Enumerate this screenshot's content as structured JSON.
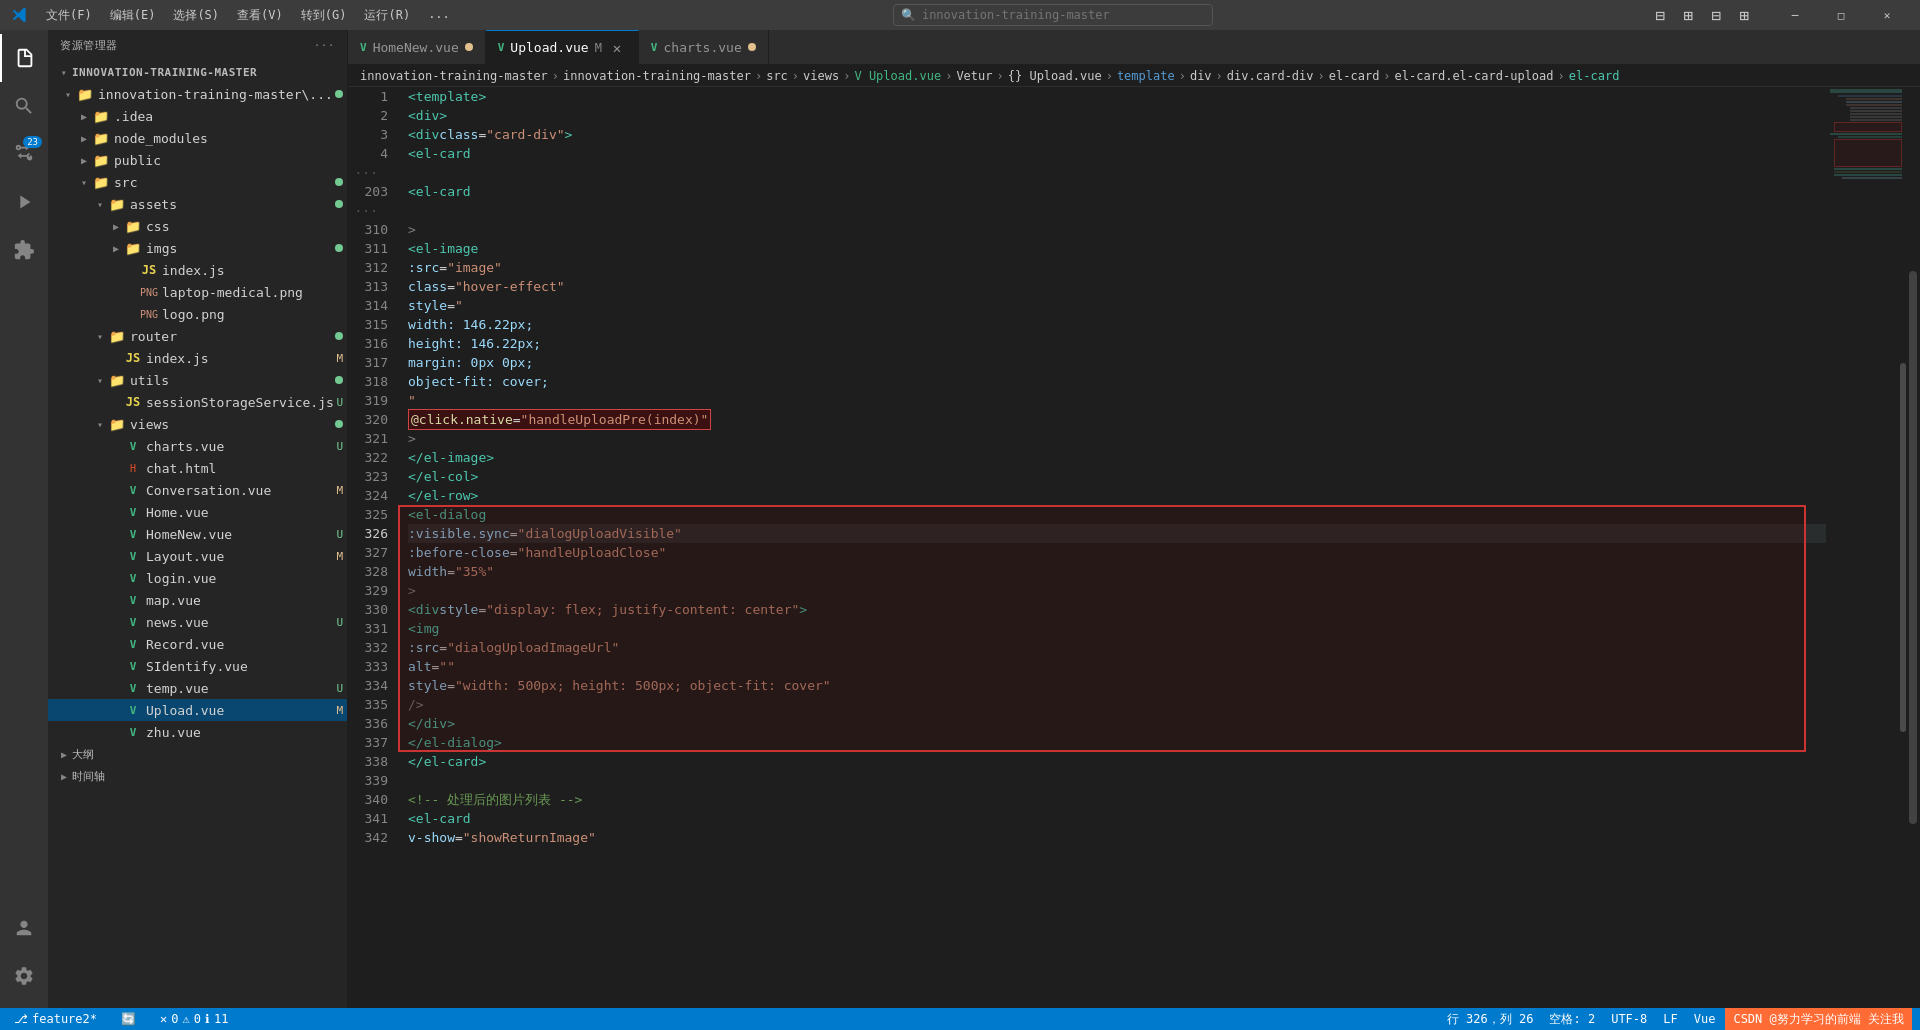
{
  "titlebar": {
    "menu_items": [
      "文件(F)",
      "编辑(E)",
      "选择(S)",
      "查看(V)",
      "转到(G)",
      "运行(R)",
      "..."
    ],
    "search_placeholder": "innovation-training-master",
    "win_min": "─",
    "win_max": "□",
    "win_close": "✕"
  },
  "activity_bar": {
    "icons": [
      {
        "name": "explorer-icon",
        "symbol": "⎘",
        "active": true
      },
      {
        "name": "search-icon",
        "symbol": "🔍",
        "active": false
      },
      {
        "name": "source-control-icon",
        "symbol": "⎇",
        "active": false,
        "badge": "23"
      },
      {
        "name": "run-icon",
        "symbol": "▷",
        "active": false
      },
      {
        "name": "extensions-icon",
        "symbol": "⊞",
        "active": false
      }
    ],
    "bottom_icons": [
      {
        "name": "account-icon",
        "symbol": "👤"
      },
      {
        "name": "settings-icon",
        "symbol": "⚙"
      }
    ]
  },
  "sidebar": {
    "title": "资源管理器",
    "root": "INNOVATION-TRAINING-MASTER",
    "tree": [
      {
        "label": "innovation-training-master\\...",
        "depth": 1,
        "type": "folder",
        "expanded": true,
        "dot": "green"
      },
      {
        "label": ".idea",
        "depth": 2,
        "type": "folder",
        "expanded": false
      },
      {
        "label": "node_modules",
        "depth": 2,
        "type": "folder",
        "expanded": false
      },
      {
        "label": "public",
        "depth": 2,
        "type": "folder",
        "expanded": false
      },
      {
        "label": "src",
        "depth": 2,
        "type": "folder",
        "expanded": true,
        "dot": "green"
      },
      {
        "label": "assets",
        "depth": 3,
        "type": "folder",
        "expanded": true,
        "dot": "green"
      },
      {
        "label": "css",
        "depth": 4,
        "type": "folder",
        "expanded": false
      },
      {
        "label": "imgs",
        "depth": 4,
        "type": "folder",
        "expanded": false,
        "dot": "green"
      },
      {
        "label": "index.js",
        "depth": 4,
        "type": "js"
      },
      {
        "label": "laptop-medical.png",
        "depth": 4,
        "type": "png"
      },
      {
        "label": "logo.png",
        "depth": 4,
        "type": "png"
      },
      {
        "label": "router",
        "depth": 3,
        "type": "folder",
        "expanded": true,
        "dot": "green"
      },
      {
        "label": "index.js",
        "depth": 4,
        "type": "js_m",
        "modified": true
      },
      {
        "label": "utils",
        "depth": 3,
        "type": "folder",
        "expanded": true,
        "dot": "green"
      },
      {
        "label": "sessionStorageService.js",
        "depth": 4,
        "type": "js_u",
        "modified": true
      },
      {
        "label": "views",
        "depth": 3,
        "type": "folder",
        "expanded": true,
        "dot": "green"
      },
      {
        "label": "charts.vue",
        "depth": 4,
        "type": "vue_u",
        "modified": true
      },
      {
        "label": "chat.html",
        "depth": 4,
        "type": "html"
      },
      {
        "label": "Conversation.vue",
        "depth": 4,
        "type": "vue_m",
        "modified": true
      },
      {
        "label": "Home.vue",
        "depth": 4,
        "type": "vue"
      },
      {
        "label": "HomeNew.vue",
        "depth": 4,
        "type": "vue_u",
        "modified": true
      },
      {
        "label": "Layout.vue",
        "depth": 4,
        "type": "vue_m",
        "modified": true
      },
      {
        "label": "login.vue",
        "depth": 4,
        "type": "vue"
      },
      {
        "label": "map.vue",
        "depth": 4,
        "type": "vue"
      },
      {
        "label": "news.vue",
        "depth": 4,
        "type": "vue_u",
        "modified": true
      },
      {
        "label": "Record.vue",
        "depth": 4,
        "type": "vue"
      },
      {
        "label": "SIdentify.vue",
        "depth": 4,
        "type": "vue"
      },
      {
        "label": "temp.vue",
        "depth": 4,
        "type": "vue_u",
        "modified": true
      },
      {
        "label": "Upload.vue",
        "depth": 4,
        "type": "vue_m",
        "active": true,
        "modified": true
      },
      {
        "label": "zhu.vue",
        "depth": 4,
        "type": "vue"
      },
      {
        "label": "大纲",
        "depth": 1,
        "type": "section"
      },
      {
        "label": "时间轴",
        "depth": 1,
        "type": "section"
      }
    ]
  },
  "tabs": [
    {
      "label": "HomeNew.vue",
      "modified": true,
      "active": false,
      "icon": "vue"
    },
    {
      "label": "Upload.vue",
      "modified": true,
      "active": true,
      "icon": "vue",
      "closeable": true
    },
    {
      "label": "charts.vue",
      "modified": false,
      "active": false,
      "icon": "vue"
    }
  ],
  "breadcrumb": {
    "items": [
      "innovation-training-master",
      "innovation-training-master",
      "src",
      "views",
      "Upload.vue",
      "Vetur",
      "{}",
      "Upload.vue",
      "template",
      "div",
      "div.card-div",
      "el-card",
      "el-card.el-card-upload",
      "el-card"
    ]
  },
  "code": {
    "lines": [
      {
        "num": 1,
        "content": "<template>"
      },
      {
        "num": 2,
        "content": "  <div>"
      },
      {
        "num": 3,
        "content": "    <div class=\"card-div\">"
      },
      {
        "num": 4,
        "content": "      <el-card"
      },
      {
        "num": 203,
        "content": "        <el-card"
      },
      {
        "num": 310,
        "content": "          >"
      },
      {
        "num": 311,
        "content": "            <el-image"
      },
      {
        "num": 312,
        "content": "              :src=\"image\""
      },
      {
        "num": 313,
        "content": "              class=\"hover-effect\""
      },
      {
        "num": 314,
        "content": "              style=\""
      },
      {
        "num": 315,
        "content": "                width: 146.22px;"
      },
      {
        "num": 316,
        "content": "                height: 146.22px;"
      },
      {
        "num": 317,
        "content": "                margin: 0px 0px;"
      },
      {
        "num": 318,
        "content": "                object-fit: cover;"
      },
      {
        "num": 319,
        "content": "              \""
      },
      {
        "num": 320,
        "content": "              @click.native=\"handleUploadPre(index)\"",
        "highlight_red": true
      },
      {
        "num": 321,
        "content": "            >"
      },
      {
        "num": 322,
        "content": "            </el-image>"
      },
      {
        "num": 323,
        "content": "          </el-col>"
      },
      {
        "num": 324,
        "content": "        </el-row>"
      },
      {
        "num": 325,
        "content": "        <el-dialog",
        "dialog_start": true
      },
      {
        "num": 326,
        "content": "          :visible.sync=\"dialogUploadVisible\"",
        "current": true
      },
      {
        "num": 327,
        "content": "          :before-close=\"handleUploadClose\""
      },
      {
        "num": 328,
        "content": "          width=\"35%\""
      },
      {
        "num": 329,
        "content": "        >"
      },
      {
        "num": 330,
        "content": "          <div style=\"display: flex; justify-content: center\">"
      },
      {
        "num": 331,
        "content": "            <img"
      },
      {
        "num": 332,
        "content": "              :src=\"dialogUploadImageUrl\""
      },
      {
        "num": 333,
        "content": "              alt=\"\""
      },
      {
        "num": 334,
        "content": "              style=\"width: 500px; height: 500px; object-fit: cover\""
      },
      {
        "num": 335,
        "content": "            />"
      },
      {
        "num": 336,
        "content": "          </div>"
      },
      {
        "num": 337,
        "content": "        </el-dialog>",
        "dialog_end": true
      },
      {
        "num": 338,
        "content": "      </el-card>"
      },
      {
        "num": 339,
        "content": ""
      },
      {
        "num": 340,
        "content": "      <!-- 处理后的图片列表 -->"
      },
      {
        "num": 341,
        "content": "      <el-card"
      },
      {
        "num": 342,
        "content": "        v-show=\"showReturnImage\""
      }
    ]
  },
  "status_bar": {
    "branch": "feature2*",
    "sync_icon": "🔄",
    "errors": "0",
    "warnings": "0",
    "info": "11",
    "cursor": "行 326，列 26",
    "spaces": "空格: 2",
    "encoding": "UTF-8",
    "line_ending": "LF",
    "language": "Vue",
    "brand": "CSDN @努力学习的前端 关注我"
  }
}
